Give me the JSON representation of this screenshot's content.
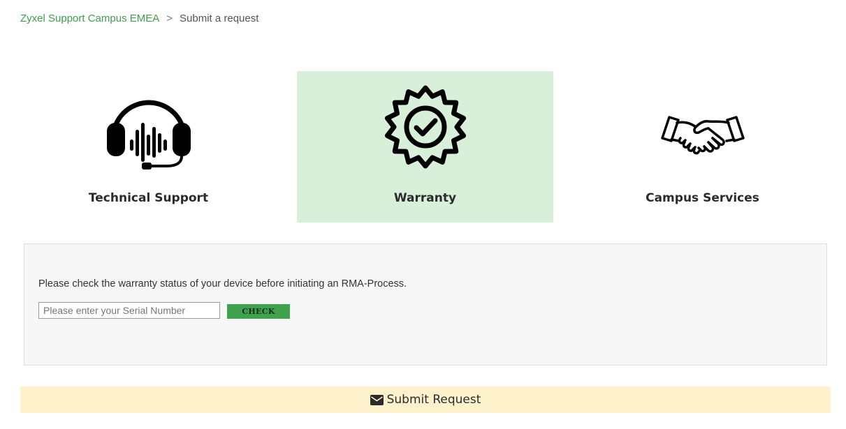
{
  "breadcrumb": {
    "home": "Zyxel Support Campus EMEA",
    "separator": ">",
    "current": "Submit a request"
  },
  "tiles": [
    {
      "label": "Technical Support",
      "icon": "headset-icon",
      "selected": false
    },
    {
      "label": "Warranty",
      "icon": "warranty-badge-icon",
      "selected": true
    },
    {
      "label": "Campus Services",
      "icon": "handshake-icon",
      "selected": false
    }
  ],
  "warranty": {
    "prompt": "Please check the warranty status of your device before initiating an RMA-Process.",
    "serial_value": "",
    "serial_placeholder": "Please enter your Serial Number",
    "check_label": "CHECK"
  },
  "submit": {
    "label": "Submit Request",
    "icon": "envelope-icon"
  },
  "colors": {
    "brand_green": "#3fa34d",
    "selected_tile_bg": "#d8f0da",
    "submit_bar_bg": "#fdf2cc",
    "panel_bg": "#f8f7f7"
  }
}
